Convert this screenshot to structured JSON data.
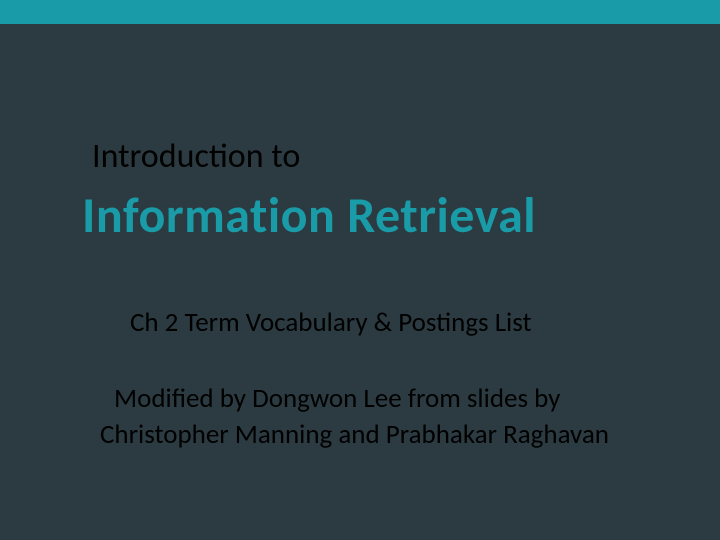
{
  "kicker": "Introduction to",
  "title": "Information Retrieval",
  "subtitle": "Ch 2 Term Vocabulary & Postings List",
  "attribution_line1": "Modified by Dongwon Lee from slides by",
  "attribution_line2": "Christopher Manning and Prabhakar Raghavan"
}
